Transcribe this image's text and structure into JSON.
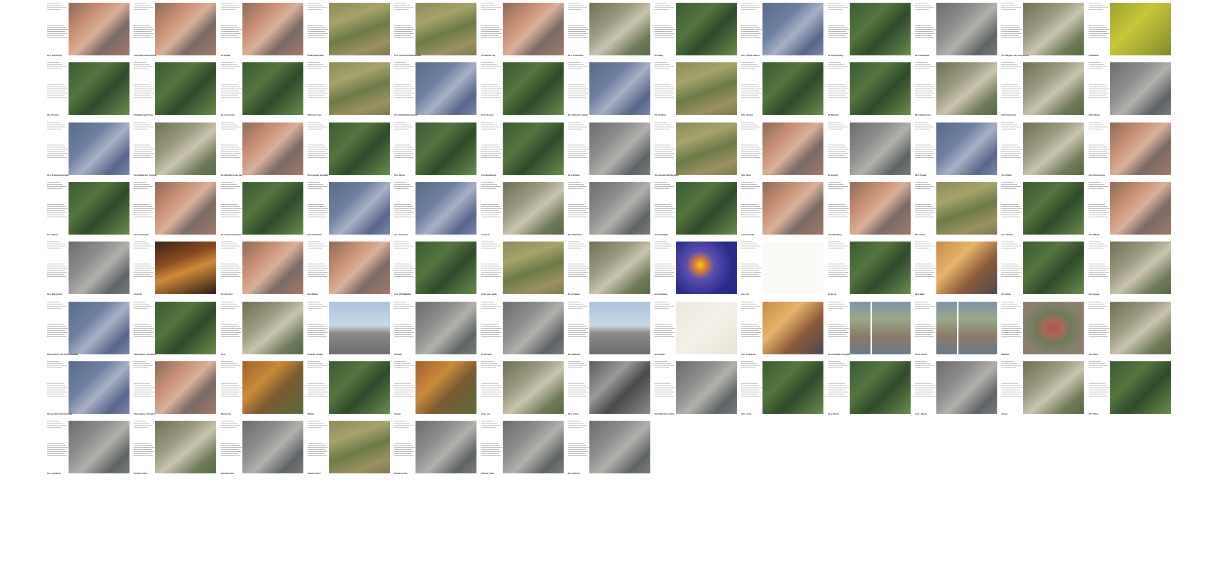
{
  "contact_sheet": {
    "rows": [
      {
        "pages": [
          {
            "caption": "03 a Vinohrady",
            "theme": "aerial-city"
          },
          {
            "caption": "03 b Žižkov Barrandov",
            "theme": "aerial-city"
          },
          {
            "caption": "03 Invalid",
            "theme": "aerial-city"
          },
          {
            "caption": "03 Blinded fields",
            "theme": "fields"
          },
          {
            "caption": "03 d industrial Statesticism",
            "theme": "fields"
          },
          {
            "caption": "03 a Block city",
            "theme": "aerial-city"
          },
          {
            "caption": "03 a Tischweiler",
            "theme": "hill"
          },
          {
            "caption": "03 Valley",
            "theme": "forest"
          },
          {
            "caption": "03 a Třebíč-Jadran",
            "theme": "city-blue"
          },
          {
            "caption": "03 Vinohradsky",
            "theme": "forest"
          },
          {
            "caption": "03 a Stavebník",
            "theme": "industrial"
          },
          {
            "caption": "03 a Region tier suspension",
            "theme": "hill"
          },
          {
            "caption": "03 Radotín",
            "theme": "yellow"
          }
        ]
      },
      {
        "pages": [
          {
            "caption": "03 a Prostor",
            "theme": "forest"
          },
          {
            "caption": "03 Mydlovary Trosy",
            "theme": "forest"
          },
          {
            "caption": "03 a Petrovice",
            "theme": "forest"
          },
          {
            "caption": "03 forest road",
            "theme": "fields"
          },
          {
            "caption": "03 a Sídliště Barrandov",
            "theme": "city-blue"
          },
          {
            "caption": "03 a Vlrovice",
            "theme": "forest"
          },
          {
            "caption": "03 a Vltavské zátoky",
            "theme": "city-blue"
          },
          {
            "caption": "03 a Třeboň",
            "theme": "fields"
          },
          {
            "caption": "03 a Vlnové",
            "theme": "forest"
          },
          {
            "caption": "03 Přelouč",
            "theme": "forest"
          },
          {
            "caption": "03 a Dumbrovice",
            "theme": "hill"
          },
          {
            "caption": "03 Krušnohoří",
            "theme": "hill"
          },
          {
            "caption": "03 Frydlant",
            "theme": "industrial"
          }
        ]
      },
      {
        "pages": [
          {
            "caption": "03 a Průmyslová hala",
            "theme": "city-blue"
          },
          {
            "caption": "03 a Obkleství, Přelouč",
            "theme": "hill"
          },
          {
            "caption": "03 a Motokrosová trať",
            "theme": "aerial-city"
          },
          {
            "caption": "03 a Lánský lesopark",
            "theme": "forest"
          },
          {
            "caption": "03 a Obora",
            "theme": "forest"
          },
          {
            "caption": "03 a Strakonice",
            "theme": "forest"
          },
          {
            "caption": "03 a Zlínské",
            "theme": "industrial"
          },
          {
            "caption": "03 a Veselí nad Moravou",
            "theme": "fields"
          },
          {
            "caption": "03 a Dubí",
            "theme": "aerial-city"
          },
          {
            "caption": "03 a Hody",
            "theme": "industrial"
          },
          {
            "caption": "03 a Trnava",
            "theme": "city-blue"
          },
          {
            "caption": "03 a Tahiti",
            "theme": "hill"
          },
          {
            "caption": "03 a Průmyslová",
            "theme": "aerial-city"
          }
        ]
      },
      {
        "pages": [
          {
            "caption": "03 a Řehek",
            "theme": "forest"
          },
          {
            "caption": "03 a Vinohrady",
            "theme": "aerial-city"
          },
          {
            "caption": "03 a Ochranné pásmo",
            "theme": "forest"
          },
          {
            "caption": "03 a Pardubice",
            "theme": "city-blue"
          },
          {
            "caption": "03 a Nová Ves",
            "theme": "city-blue"
          },
          {
            "caption": "03 a Ústí",
            "theme": "hill"
          },
          {
            "caption": "03 a Malé Kolo",
            "theme": "industrial"
          },
          {
            "caption": "03 a Podskalí",
            "theme": "forest"
          },
          {
            "caption": "3 4 a kostelní",
            "theme": "aerial-city"
          },
          {
            "caption": "03 a Slatiňany",
            "theme": "aerial-city"
          },
          {
            "caption": "03 a Úvaly",
            "theme": "fields"
          },
          {
            "caption": "03 a Hrádek",
            "theme": "forest"
          },
          {
            "caption": "03 a Mělník",
            "theme": "aerial-city"
          }
        ]
      },
      {
        "pages": [
          {
            "caption": "03 a Starý most",
            "theme": "industrial"
          },
          {
            "caption": "03 a Trh",
            "theme": "market"
          },
          {
            "caption": "03 a Prostor",
            "theme": "aerial-city"
          },
          {
            "caption": "03 a Město",
            "theme": "aerial-city"
          },
          {
            "caption": "03 a STOMMÉRA",
            "theme": "forest"
          },
          {
            "caption": "03 a Lesní okraj",
            "theme": "fields"
          },
          {
            "caption": "03 a Krajina",
            "theme": "hill"
          },
          {
            "caption": "03 a Hustota",
            "theme": "heatmap"
          },
          {
            "caption": "03 a Síť",
            "theme": "map-lines"
          },
          {
            "caption": "03 a Les",
            "theme": "forest"
          },
          {
            "caption": "03 a Skály",
            "theme": "sunset"
          },
          {
            "caption": "03 a Pole",
            "theme": "forest"
          },
          {
            "caption": "03 a Kopce",
            "theme": "hill"
          }
        ]
      },
      {
        "pages": [
          {
            "caption": "Observation 7th district heating",
            "theme": "city-blue"
          },
          {
            "caption": "Observation Strnadce",
            "theme": "forest"
          },
          {
            "caption": "Brno",
            "theme": "hill"
          },
          {
            "caption": "Pražské hradby",
            "theme": "sky"
          },
          {
            "caption": "Přehled",
            "theme": "industrial"
          },
          {
            "caption": "03 a Praha",
            "theme": "industrial"
          },
          {
            "caption": "03 a Náměstí",
            "theme": "sky"
          },
          {
            "caption": "03 a mapa",
            "theme": "map-pale"
          },
          {
            "caption": "03 a Katedrála",
            "theme": "sunset"
          },
          {
            "caption": "03 a Přehled fotografií",
            "theme": "grid-photos"
          },
          {
            "caption": "Stolní obraz",
            "theme": "grid-photos"
          },
          {
            "caption": "Stadion",
            "theme": "pitch"
          },
          {
            "caption": "03 a Obec",
            "theme": "hill"
          }
        ]
      },
      {
        "pages": [
          {
            "caption": "Observation Vinohradsky",
            "theme": "city-blue"
          },
          {
            "caption": "Observation Strnadce",
            "theme": "aerial-city"
          },
          {
            "caption": "Mapa lomu",
            "theme": "autumn"
          },
          {
            "caption": "Oblast",
            "theme": "forest"
          },
          {
            "caption": "Zámek",
            "theme": "autumn"
          },
          {
            "caption": "03 a Lom",
            "theme": "hill"
          },
          {
            "caption": "03 a Archiv",
            "theme": "bw"
          },
          {
            "caption": "03 a Panelové domy",
            "theme": "industrial"
          },
          {
            "caption": "03 a Lomy",
            "theme": "forest"
          },
          {
            "caption": "03 a Jezera",
            "theme": "forest"
          },
          {
            "caption": "Ústí + Ohare",
            "theme": "industrial"
          },
          {
            "caption": "Ohare",
            "theme": "hill"
          },
          {
            "caption": "03 a Obce",
            "theme": "forest"
          }
        ]
      },
      {
        "pages": [
          {
            "caption": "03 a Vytěžená",
            "theme": "industrial"
          },
          {
            "caption": "Planina Cihel",
            "theme": "hill"
          },
          {
            "caption": "Planina Cihel",
            "theme": "industrial"
          },
          {
            "caption": "Planina Cihel",
            "theme": "fields"
          },
          {
            "caption": "Planina Cihel",
            "theme": "industrial"
          },
          {
            "caption": "Planina Cihel",
            "theme": "industrial"
          },
          {
            "caption": "03 a Přehled",
            "theme": "industrial"
          }
        ]
      }
    ]
  }
}
